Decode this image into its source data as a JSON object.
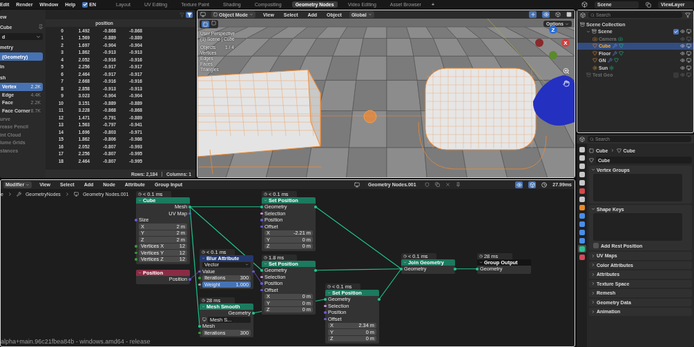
{
  "topbar": {
    "menus": [
      "Edit",
      "Render",
      "Window",
      "Help"
    ],
    "language": {
      "label": "EN",
      "checked": true
    },
    "workspaces": [
      {
        "label": "Layout",
        "selected": false
      },
      {
        "label": "UV Editing",
        "selected": false
      },
      {
        "label": "Texture Paint",
        "selected": false
      },
      {
        "label": "Shading",
        "selected": false
      },
      {
        "label": "Compositing",
        "selected": false
      },
      {
        "label": "Geometry Nodes",
        "selected": true
      },
      {
        "label": "Video Editing",
        "selected": false
      },
      {
        "label": "Asset Browser",
        "selected": false
      }
    ],
    "add_tab": "+",
    "scene": "Scene",
    "view_layer": "ViewLayer"
  },
  "spreadsheet": {
    "sidebar": [
      {
        "kind": "heading",
        "label": "ew"
      },
      {
        "kind": "object",
        "label": "Cube"
      },
      {
        "kind": "dropdown",
        "label": "d"
      },
      {
        "kind": "heading",
        "label": "metry"
      },
      {
        "kind": "item",
        "label": "(Geometry)",
        "selected": true
      },
      {
        "kind": "heading",
        "label": "in"
      },
      {
        "kind": "heading",
        "label": "sh"
      },
      {
        "kind": "domain",
        "label": "Vertex",
        "count": "2.2K",
        "selected": true
      },
      {
        "kind": "domain",
        "label": "Edge",
        "count": "4.4K",
        "selected": false
      },
      {
        "kind": "domain",
        "label": "Face",
        "count": "2.2K",
        "selected": false
      },
      {
        "kind": "domain",
        "label": "Face Corner",
        "count": "8.7K",
        "selected": false
      },
      {
        "kind": "disabled",
        "label": "urve"
      },
      {
        "kind": "disabled",
        "label": "rease Pencil"
      },
      {
        "kind": "disabled",
        "label": "int Cloud"
      },
      {
        "kind": "disabled",
        "label": "lume Grids"
      },
      {
        "kind": "disabled",
        "label": "stances"
      }
    ],
    "column": "position",
    "rows": [
      [
        "0",
        "1.492",
        "-0.868",
        "-0.868"
      ],
      [
        "1",
        "1.569",
        "-0.889",
        "-0.889"
      ],
      [
        "2",
        "1.697",
        "-0.904",
        "-0.904"
      ],
      [
        "3",
        "1.862",
        "-0.913",
        "-0.913"
      ],
      [
        "4",
        "2.052",
        "-0.916",
        "-0.916"
      ],
      [
        "5",
        "2.256",
        "-0.917",
        "-0.917"
      ],
      [
        "6",
        "2.464",
        "-0.917",
        "-0.917"
      ],
      [
        "7",
        "2.668",
        "-0.916",
        "-0.916"
      ],
      [
        "8",
        "2.858",
        "-0.913",
        "-0.913"
      ],
      [
        "9",
        "3.023",
        "-0.904",
        "-0.904"
      ],
      [
        "10",
        "3.151",
        "-0.889",
        "-0.889"
      ],
      [
        "11",
        "3.228",
        "-0.868",
        "-0.868"
      ],
      [
        "12",
        "1.471",
        "-0.791",
        "-0.889"
      ],
      [
        "13",
        "1.563",
        "-0.797",
        "-0.941"
      ],
      [
        "14",
        "1.696",
        "-0.803",
        "-0.971"
      ],
      [
        "15",
        "1.862",
        "-0.806",
        "-0.986"
      ],
      [
        "16",
        "2.052",
        "-0.807",
        "-0.993"
      ],
      [
        "17",
        "2.256",
        "-0.807",
        "-0.995"
      ],
      [
        "18",
        "2.464",
        "-0.807",
        "-0.995"
      ]
    ],
    "footer": {
      "rows": "Rows: 2,184",
      "columns": "Columns: 1"
    }
  },
  "viewport": {
    "mode": "Object Mode",
    "menus": [
      "View",
      "Select",
      "Add",
      "Object"
    ],
    "orientation": "Global",
    "options": "Options",
    "view_name": "User Perspective",
    "context": "(1) Scene | Cube",
    "stats": [
      {
        "label": "Objects",
        "value": "1 / 4"
      },
      {
        "label": "Vertices"
      },
      {
        "label": "Edges"
      },
      {
        "label": "Faces"
      },
      {
        "label": "Triangles"
      }
    ],
    "gizmo": {
      "z": "Z",
      "x": "X"
    }
  },
  "outliner": {
    "search": {
      "placeholder": "Search"
    },
    "tree": [
      {
        "label": "Scene Collection",
        "kind": "collection",
        "children": [
          {
            "label": "Scene",
            "kind": "collection",
            "checked": true,
            "expanded": true,
            "disabled": false,
            "children": [
              {
                "label": "Camera",
                "kind": "camera",
                "selected": false,
                "disabled": true
              },
              {
                "label": "Cube",
                "kind": "mesh",
                "selected": true,
                "disabled": false
              },
              {
                "label": "Floor",
                "kind": "mesh",
                "selected": false,
                "disabled": false
              },
              {
                "label": "GN",
                "kind": "mesh",
                "selected": false,
                "disabled": false
              },
              {
                "label": "Sun",
                "kind": "light",
                "selected": false,
                "disabled": false
              }
            ]
          },
          {
            "label": "Test Geo",
            "kind": "collection",
            "checked": false,
            "disabled": true
          }
        ]
      }
    ]
  },
  "properties": {
    "search": {
      "placeholder": "Search"
    },
    "tabs": [
      {
        "color": "#c8c8c8",
        "selected": false
      },
      {
        "color": "#c8c8c8",
        "selected": false
      },
      {
        "color": "#c8c8c8",
        "selected": false
      },
      {
        "color": "#c8c8c8",
        "selected": false
      },
      {
        "color": "#c8c8c8",
        "selected": false
      },
      {
        "color": "#d24a4a",
        "selected": false
      },
      {
        "color": "#c8c8c8",
        "selected": false
      },
      {
        "color": "#e88a2a",
        "selected": false
      },
      {
        "color": "#4a8ee8",
        "selected": false
      },
      {
        "color": "#4a8ee8",
        "selected": false
      },
      {
        "color": "#4a8ee8",
        "selected": false
      },
      {
        "color": "#4a8ee8",
        "selected": false
      },
      {
        "color": "#2fbf8f",
        "selected": true
      },
      {
        "color": "#d24a5a",
        "selected": false
      }
    ],
    "breadcrumb": [
      "Cube",
      "Cube"
    ],
    "data_name": "Cube",
    "panels": [
      {
        "label": "Vertex Groups",
        "expanded": true
      },
      {
        "label": "Shape Keys",
        "expanded": true,
        "option": {
          "label": "Add Rest Position",
          "checked": false
        }
      },
      {
        "label": "UV Maps",
        "expanded": false
      },
      {
        "label": "Color Attributes",
        "expanded": false
      },
      {
        "label": "Attributes",
        "expanded": false
      },
      {
        "label": "Texture Space",
        "expanded": false
      },
      {
        "label": "Remesh",
        "expanded": false
      },
      {
        "label": "Geometry Data",
        "expanded": false
      },
      {
        "label": "Animation",
        "expanded": false
      }
    ]
  },
  "node_editor": {
    "menus": [
      {
        "label": "Modifier",
        "dropdown": true
      },
      {
        "label": "View",
        "dropdown": false
      },
      {
        "label": "Select",
        "dropdown": false
      },
      {
        "label": "Add",
        "dropdown": false
      },
      {
        "label": "Node",
        "dropdown": false
      },
      {
        "label": "Attribute",
        "dropdown": false
      },
      {
        "label": "Group Input",
        "dropdown": false
      }
    ],
    "tree_name": "Geometry Nodes.001",
    "timing": "27.99ms",
    "breadcrumb": [
      "e",
      "GeometryNodes",
      "Geometry Nodes.001"
    ],
    "nodes": [
      {
        "title": "Cube",
        "kind": "geometry",
        "time": "< 0.1 ms",
        "rows": [
          {
            "kind": "output",
            "label": "Mesh",
            "color": "#1fc48e"
          },
          {
            "kind": "output",
            "label": "UV Map",
            "color": "#6a5ad8"
          },
          {
            "kind": "input",
            "label": "Size",
            "color": "#6a5ad8"
          },
          {
            "kind": "field",
            "label": "X",
            "value": "2 m",
            "active": false
          },
          {
            "kind": "field",
            "label": "Y",
            "value": "2 m",
            "active": false
          },
          {
            "kind": "field",
            "label": "Z",
            "value": "2 m",
            "active": false
          },
          {
            "kind": "field",
            "label": "Vertices X",
            "value": "12",
            "color": "#3a9a3a",
            "active": false
          },
          {
            "kind": "field",
            "label": "Vertices Y",
            "value": "12",
            "color": "#3a9a3a",
            "active": false
          },
          {
            "kind": "field",
            "label": "Vertices Z",
            "value": "12",
            "color": "#3a9a3a",
            "active": false
          }
        ]
      },
      {
        "title": "Position",
        "kind": "input",
        "rows": [
          {
            "kind": "output",
            "label": "Position",
            "color": "#6a5ad8"
          }
        ]
      },
      {
        "title": "Blur Attribute",
        "kind": "converter",
        "time": "< 0.1 ms",
        "rows": [
          {
            "kind": "dropdown",
            "label": "Vector"
          },
          {
            "kind": "both",
            "label": "Value",
            "color": "#6a5ad8"
          },
          {
            "kind": "field",
            "label": "Iterations",
            "value": "300",
            "color": "#3a9a3a",
            "active": false
          },
          {
            "kind": "field",
            "label": "Weight",
            "value": "1.000",
            "color": "#a0a0a0",
            "active": true
          }
        ]
      },
      {
        "title": "Mesh Smooth",
        "kind": "geometry",
        "time": "28 ms",
        "rows": [
          {
            "kind": "output",
            "label": "Geometry",
            "color": "#1fc48e"
          },
          {
            "kind": "datablock",
            "label": "Mesh S..."
          },
          {
            "kind": "input",
            "label": "Mesh",
            "color": "#1fc48e"
          },
          {
            "kind": "field",
            "label": "Iterations",
            "value": "300",
            "color": "#3a9a3a",
            "active": false
          }
        ]
      },
      {
        "title": "Set Position",
        "kind": "geometry",
        "time": "< 0.1 ms",
        "rows": [
          {
            "kind": "both",
            "label": "Geometry",
            "color": "#1fc48e"
          },
          {
            "kind": "input",
            "label": "Selection",
            "color": "#d48ad4"
          },
          {
            "kind": "input",
            "label": "Position",
            "color": "#6a5ad8"
          },
          {
            "kind": "input",
            "label": "Offset",
            "color": "#6a5ad8"
          },
          {
            "kind": "field",
            "label": "X",
            "value": "-2.21 m",
            "active": false
          },
          {
            "kind": "field",
            "label": "Y",
            "value": "0 m",
            "active": false
          },
          {
            "kind": "field",
            "label": "Z",
            "value": "0 m",
            "active": false
          }
        ]
      },
      {
        "title": "Set Position",
        "kind": "geometry",
        "time": "1.8 ms",
        "rows": [
          {
            "kind": "both",
            "label": "Geometry",
            "color": "#1fc48e"
          },
          {
            "kind": "input",
            "label": "Selection",
            "color": "#d48ad4"
          },
          {
            "kind": "input",
            "label": "Position",
            "color": "#6a5ad8"
          },
          {
            "kind": "input",
            "label": "Offset",
            "color": "#6a5ad8"
          },
          {
            "kind": "field",
            "label": "X",
            "value": "0 m",
            "active": false
          },
          {
            "kind": "field",
            "label": "Y",
            "value": "0 m",
            "active": false
          },
          {
            "kind": "field",
            "label": "Z",
            "value": "0 m",
            "active": false
          }
        ]
      },
      {
        "title": "Set Position",
        "kind": "geometry",
        "time": "< 0.1 ms",
        "rows": [
          {
            "kind": "both",
            "label": "Geometry",
            "color": "#1fc48e"
          },
          {
            "kind": "input",
            "label": "Selection",
            "color": "#d48ad4"
          },
          {
            "kind": "input",
            "label": "Position",
            "color": "#6a5ad8"
          },
          {
            "kind": "input",
            "label": "Offset",
            "color": "#6a5ad8"
          },
          {
            "kind": "field",
            "label": "X",
            "value": "2.34 m",
            "active": false
          },
          {
            "kind": "field",
            "label": "Y",
            "value": "0 m",
            "active": false
          },
          {
            "kind": "field",
            "label": "Z",
            "value": "0 m",
            "active": false
          }
        ]
      },
      {
        "title": "Join Geometry",
        "kind": "geometry",
        "time": "< 0.1 ms",
        "rows": [
          {
            "kind": "both",
            "label": "Geometry",
            "color": "#1fc48e"
          }
        ]
      },
      {
        "title": "Group Output",
        "kind": "output",
        "time": "28 ms",
        "rows": [
          {
            "kind": "input",
            "label": "Geometry",
            "color": "#1fc48e"
          }
        ]
      }
    ],
    "version": "alpha+main.96c21fbea84b - windows.amd64 - release"
  }
}
